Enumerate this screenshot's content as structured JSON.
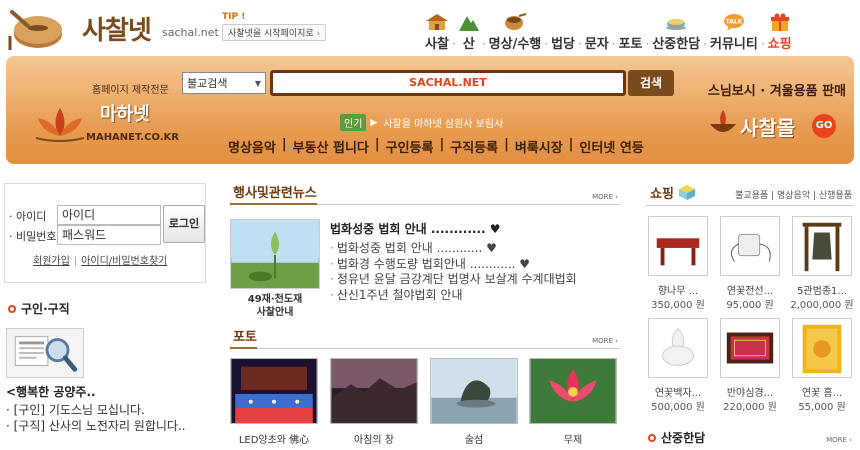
{
  "header": {
    "logo_text": "사찰넷",
    "logo_domain": "sachal.net",
    "tip_label": "TIP !",
    "tip_button": "사찰넷을 시작페이지로",
    "nav": [
      {
        "label": "사찰",
        "icon": "temple-icon"
      },
      {
        "label": "산",
        "icon": "mountain-icon"
      },
      {
        "label": "명상/수행",
        "icon": "singing-bowl-icon"
      },
      {
        "label": "법당",
        "icon": ""
      },
      {
        "label": "문자",
        "icon": ""
      },
      {
        "label": "포토",
        "icon": ""
      },
      {
        "label": "산중한담",
        "icon": "tea-cup-icon"
      },
      {
        "label": "커뮤니티",
        "icon": "talk-bubble-icon"
      },
      {
        "label": "쇼핑",
        "icon": "gift-box-icon"
      }
    ],
    "talk_badge": "TALK"
  },
  "banner": {
    "mahanet_sub": "홈페이지 제작전문",
    "mahanet_name": "마하넷",
    "mahanet_domain": "MAHANET.CO.KR",
    "search_select": "불교검색",
    "search_value": "SACHAL.NET",
    "search_button": "검색",
    "popular_badge": "인기",
    "popular_text": "사찰을 마하넷 삼원사 보림사",
    "links": [
      "명상음악",
      "부동산 펍니다",
      "구인등록",
      "구직등록",
      "벼룩시장",
      "인터넷 연등"
    ],
    "mall_head": "스님보시 · 겨울용품 판매",
    "mall_name": "사찰몰",
    "mall_go": "GO"
  },
  "login": {
    "id_label": "· 아이디",
    "pw_label": "· 비밀번호",
    "id_value": "아이디",
    "pw_value": "패스워드",
    "login_button": "로그인",
    "join": "회원가입",
    "find": "아이디/비밀번호찾기"
  },
  "jobs": {
    "title": "구인·구직",
    "headline": "<행복한 공양주..",
    "items": [
      "· [구인] 기도스님 모십니다.",
      "· [구직] 산사의 노전자리 원합니다.."
    ]
  },
  "news": {
    "title": "행사및관련뉴스",
    "more": "MORE ›",
    "thumb_caption_1": "49재·천도재",
    "thumb_caption_2": "사찰안내",
    "top": "법화성중 법회 안내 ............ ♥",
    "items": [
      "법화성중 법회 안내 ............ ♥",
      "법화경 수행도량 법회안내 ............ ♥",
      "정유년 윤달 금강계단 법명사 보살계 수계대법회",
      "산신1주년 철야법회 안내"
    ]
  },
  "photo": {
    "title": "포토",
    "more": "MORE ›",
    "items": [
      "LED양초와 佛心",
      "아침의 창",
      "술섬",
      "무제"
    ]
  },
  "shop": {
    "title": "쇼핑",
    "categories": "불교용품 | 명상음악 | 산행용품",
    "products": [
      {
        "name": "향나무 ...",
        "price": "350,000 원"
      },
      {
        "name": "연꽃전선...",
        "price": "95,000 원"
      },
      {
        "name": "5관범종1...",
        "price": "2,000,000 원"
      },
      {
        "name": "연꽃백자...",
        "price": "500,000 원"
      },
      {
        "name": "반야심경...",
        "price": "220,000 원"
      },
      {
        "name": "연꽃 홈...",
        "price": "55,000 원"
      }
    ],
    "talk_title": "산중한담",
    "more": "MORE ›"
  },
  "colors": {
    "banner_orange": "#e79a4f",
    "brand_brown": "#7a4b1d",
    "accent_red": "#e8431c",
    "popular_green": "#5d9b3b"
  }
}
